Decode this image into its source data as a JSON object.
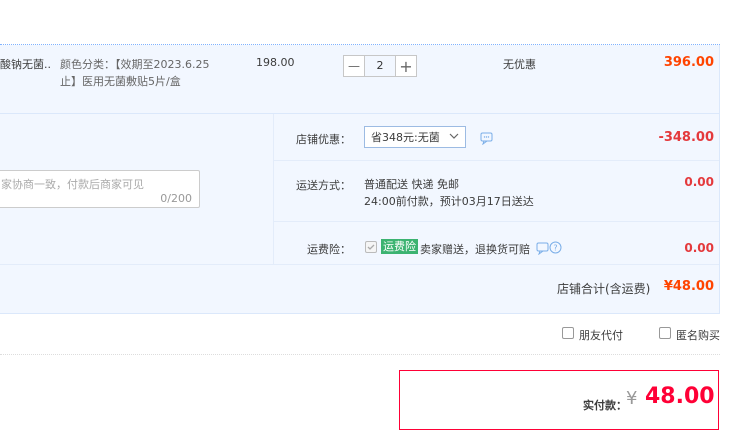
{
  "item": {
    "title_fragment": "酸钠无菌...",
    "spec_line1": "颜色分类：【效期至2023.6.25",
    "spec_line2": "止】医用无菌敷贴5片/盒",
    "unit_price": "198.00",
    "quantity": "2",
    "minus_label": "—",
    "plus_label": "+",
    "discount": "无优惠",
    "subtotal": "396.00"
  },
  "shop": {
    "coupon_label": "店铺优惠：",
    "coupon_selected": "省348元:无菌",
    "coupon_amount": "-348.00",
    "message_placeholder": "家协商一致，付款后商家可见",
    "message_count": "0/200",
    "shipping_label": "运送方式：",
    "shipping_line1": "普通配送 快递 免邮",
    "shipping_line2": "24:00前付款，预计03月17日送达",
    "shipping_amount": "0.00",
    "insurance_label": "运费险：",
    "insurance_badge": "运费险",
    "insurance_text": "卖家赠送，退换货可赔",
    "insurance_amount": "0.00",
    "total_label": "店铺合计(含运费)",
    "total_amount": "¥48.00"
  },
  "options": {
    "friend_pay": "朋友代付",
    "anonymous": "匿名购买"
  },
  "payment": {
    "label": "实付款：",
    "currency": "¥",
    "amount": "48.00"
  },
  "colors": {
    "accent": "#ff4400",
    "border_blue": "#b2d1ff",
    "panel_bg": "#f2f7ff",
    "pay_border": "#ff0036"
  }
}
